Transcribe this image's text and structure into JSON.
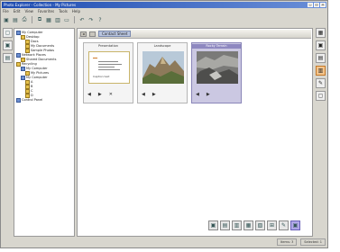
{
  "window": {
    "title": "Photo Explorer - Collection - My Pictures",
    "minimize_glyph": "_",
    "maximize_glyph": "□",
    "close_glyph": "×"
  },
  "menu": [
    "File",
    "Edit",
    "View",
    "Favorites",
    "Tools",
    "Help"
  ],
  "toolbar": {
    "icons": [
      "save-icon",
      "open-icon",
      "print-icon",
      "copy-icon",
      "paste-icon",
      "image-icon",
      "slideshow-icon",
      "undo-icon",
      "redo-icon",
      "help-icon"
    ],
    "glyphs": [
      "▣",
      "▤",
      "⎙",
      "⧉",
      "▦",
      "▥",
      "▭",
      "↶",
      "↷",
      "?"
    ]
  },
  "left_strip_glyphs": [
    "▢",
    "▣",
    "▤"
  ],
  "tree": [
    {
      "label": "My Computer",
      "level": 0,
      "icon": "blue"
    },
    {
      "label": "Desktop",
      "level": 1,
      "icon": "yellow"
    },
    {
      "label": "Docs",
      "level": 2,
      "icon": "yellow"
    },
    {
      "label": "My Documents",
      "level": 2,
      "icon": "yellow"
    },
    {
      "label": "Sample Photos",
      "level": 2,
      "icon": "yellow"
    },
    {
      "label": "Network Places",
      "level": 0,
      "icon": "blue"
    },
    {
      "label": "Shared Documents",
      "level": 1,
      "icon": "yellow"
    },
    {
      "label": "Recycling",
      "level": 0,
      "icon": "yellow"
    },
    {
      "label": "My Computer",
      "level": 1,
      "icon": "blue"
    },
    {
      "label": "My Pictures",
      "level": 2,
      "icon": "yellow"
    },
    {
      "label": "My Computer",
      "level": 1,
      "icon": "blue"
    },
    {
      "label": "A",
      "level": 2,
      "icon": "yellow"
    },
    {
      "label": "B",
      "level": 2,
      "icon": "yellow"
    },
    {
      "label": "C",
      "level": 2,
      "icon": "yellow"
    },
    {
      "label": "D",
      "level": 2,
      "icon": "yellow"
    },
    {
      "label": "Control Panel",
      "level": 0,
      "icon": "blue"
    }
  ],
  "main_header": {
    "back_glyph": "◂",
    "label": "Contact Sheet"
  },
  "cards": [
    {
      "title": "Presentation",
      "type": "document",
      "doc_label": "Caption text"
    },
    {
      "title": "Landscape",
      "type": "mountain"
    },
    {
      "title": "Rocky Terrain",
      "type": "rocks",
      "selected": true
    }
  ],
  "card_controls": [
    "◀",
    "▶",
    "✕"
  ],
  "right_panel_glyphs": [
    "▦",
    "▣",
    "▤",
    "▥",
    "✎",
    "▢"
  ],
  "bottom_toolbar_glyphs": [
    "▣",
    "▤",
    "▥",
    "▦",
    "▧",
    "⊞",
    "✎",
    "▣"
  ],
  "status": [
    "Items: 3",
    "Selected: 1"
  ],
  "colors": {
    "title_bar": "#1d4bb0",
    "selection": "#cbc8e2"
  }
}
